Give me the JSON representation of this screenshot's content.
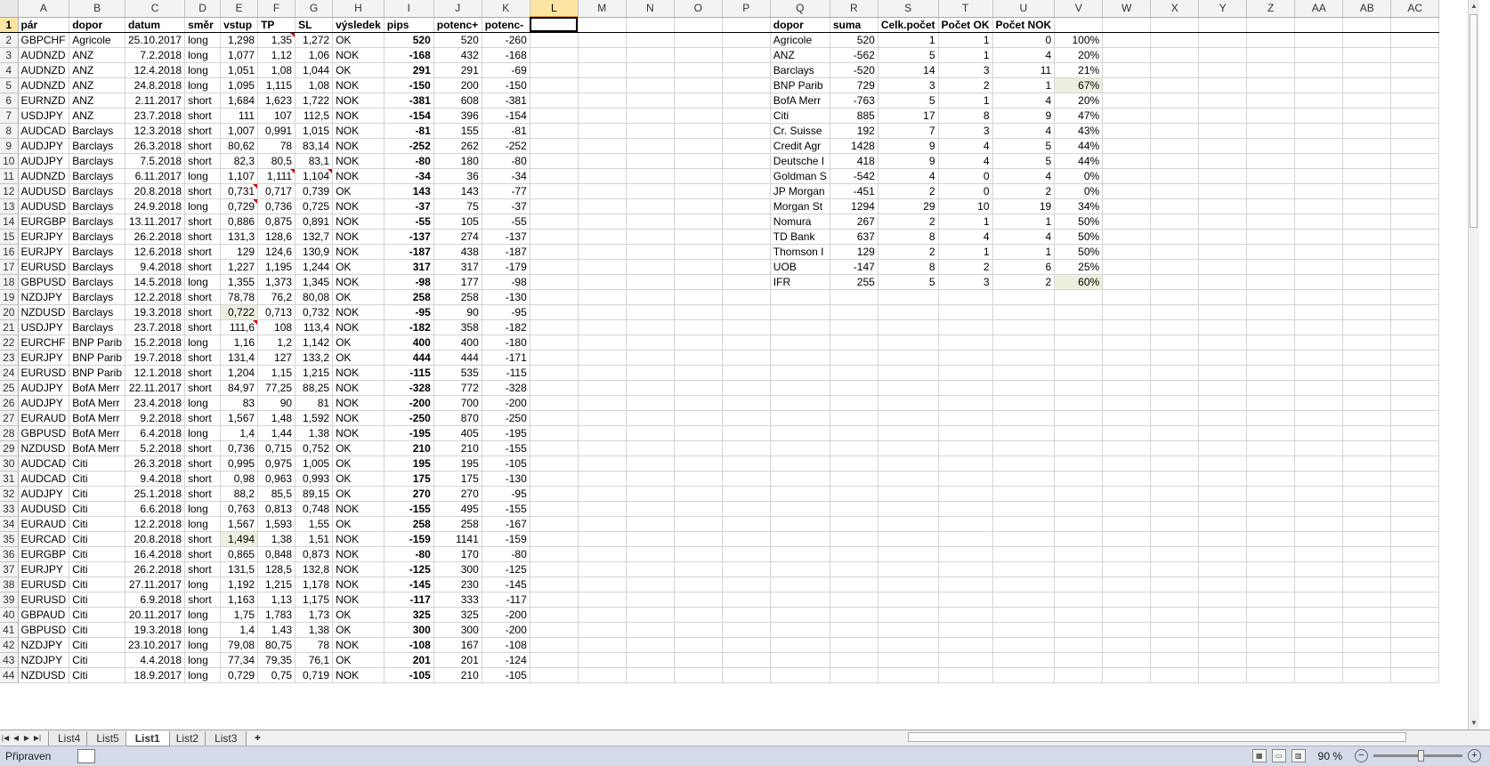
{
  "columns": [
    "A",
    "B",
    "C",
    "D",
    "E",
    "F",
    "G",
    "H",
    "I",
    "J",
    "K",
    "L",
    "M",
    "N",
    "O",
    "P",
    "Q",
    "R",
    "S",
    "T",
    "U",
    "V",
    "W",
    "X",
    "Y",
    "Z",
    "AA",
    "AB",
    "AC"
  ],
  "left_headers": [
    "pár",
    "dopor",
    "datum",
    "směr",
    "vstup",
    "TP",
    "SL",
    "výsledek",
    "pips",
    "potenc+",
    "potenc-"
  ],
  "right_headers": [
    "dopor",
    "suma",
    "Celk.počet",
    "Počet OK",
    "Počet NOK",
    ""
  ],
  "rows": [
    [
      "GBPCHF",
      "Agricole",
      "25.10.2017",
      "long",
      "1,298",
      "1,35",
      "1,272",
      "OK",
      "520",
      "520",
      "-260"
    ],
    [
      "AUDNZD",
      "ANZ",
      "7.2.2018",
      "long",
      "1,077",
      "1,12",
      "1,06",
      "NOK",
      "-168",
      "432",
      "-168"
    ],
    [
      "AUDNZD",
      "ANZ",
      "12.4.2018",
      "long",
      "1,051",
      "1,08",
      "1,044",
      "OK",
      "291",
      "291",
      "-69"
    ],
    [
      "AUDNZD",
      "ANZ",
      "24.8.2018",
      "long",
      "1,095",
      "1,115",
      "1,08",
      "NOK",
      "-150",
      "200",
      "-150"
    ],
    [
      "EURNZD",
      "ANZ",
      "2.11.2017",
      "short",
      "1,684",
      "1,623",
      "1,722",
      "NOK",
      "-381",
      "608",
      "-381"
    ],
    [
      "USDJPY",
      "ANZ",
      "23.7.2018",
      "short",
      "111",
      "107",
      "112,5",
      "NOK",
      "-154",
      "396",
      "-154"
    ],
    [
      "AUDCAD",
      "Barclays",
      "12.3.2018",
      "short",
      "1,007",
      "0,991",
      "1,015",
      "NOK",
      "-81",
      "155",
      "-81"
    ],
    [
      "AUDJPY",
      "Barclays",
      "26.3.2018",
      "short",
      "80,62",
      "78",
      "83,14",
      "NOK",
      "-252",
      "262",
      "-252"
    ],
    [
      "AUDJPY",
      "Barclays",
      "7.5.2018",
      "short",
      "82,3",
      "80,5",
      "83,1",
      "NOK",
      "-80",
      "180",
      "-80"
    ],
    [
      "AUDNZD",
      "Barclays",
      "6.11.2017",
      "long",
      "1,107",
      "1,111",
      "1,104",
      "NOK",
      "-34",
      "36",
      "-34"
    ],
    [
      "AUDUSD",
      "Barclays",
      "20.8.2018",
      "short",
      "0,731",
      "0,717",
      "0,739",
      "OK",
      "143",
      "143",
      "-77"
    ],
    [
      "AUDUSD",
      "Barclays",
      "24.9.2018",
      "long",
      "0,729",
      "0,736",
      "0,725",
      "NOK",
      "-37",
      "75",
      "-37"
    ],
    [
      "EURGBP",
      "Barclays",
      "13.11.2017",
      "short",
      "0,886",
      "0,875",
      "0,891",
      "NOK",
      "-55",
      "105",
      "-55"
    ],
    [
      "EURJPY",
      "Barclays",
      "26.2.2018",
      "short",
      "131,3",
      "128,6",
      "132,7",
      "NOK",
      "-137",
      "274",
      "-137"
    ],
    [
      "EURJPY",
      "Barclays",
      "12.6.2018",
      "short",
      "129",
      "124,6",
      "130,9",
      "NOK",
      "-187",
      "438",
      "-187"
    ],
    [
      "EURUSD",
      "Barclays",
      "9.4.2018",
      "short",
      "1,227",
      "1,195",
      "1,244",
      "OK",
      "317",
      "317",
      "-179"
    ],
    [
      "GBPUSD",
      "Barclays",
      "14.5.2018",
      "long",
      "1,355",
      "1,373",
      "1,345",
      "NOK",
      "-98",
      "177",
      "-98"
    ],
    [
      "NZDJPY",
      "Barclays",
      "12.2.2018",
      "short",
      "78,78",
      "76,2",
      "80,08",
      "OK",
      "258",
      "258",
      "-130"
    ],
    [
      "NZDUSD",
      "Barclays",
      "19.3.2018",
      "short",
      "0,722",
      "0,713",
      "0,732",
      "NOK",
      "-95",
      "90",
      "-95"
    ],
    [
      "USDJPY",
      "Barclays",
      "23.7.2018",
      "short",
      "111,6",
      "108",
      "113,4",
      "NOK",
      "-182",
      "358",
      "-182"
    ],
    [
      "EURCHF",
      "BNP Parib",
      "15.2.2018",
      "long",
      "1,16",
      "1,2",
      "1,142",
      "OK",
      "400",
      "400",
      "-180"
    ],
    [
      "EURJPY",
      "BNP Parib",
      "19.7.2018",
      "short",
      "131,4",
      "127",
      "133,2",
      "OK",
      "444",
      "444",
      "-171"
    ],
    [
      "EURUSD",
      "BNP Parib",
      "12.1.2018",
      "short",
      "1,204",
      "1,15",
      "1,215",
      "NOK",
      "-115",
      "535",
      "-115"
    ],
    [
      "AUDJPY",
      "BofA Merr",
      "22.11.2017",
      "short",
      "84,97",
      "77,25",
      "88,25",
      "NOK",
      "-328",
      "772",
      "-328"
    ],
    [
      "AUDJPY",
      "BofA Merr",
      "23.4.2018",
      "long",
      "83",
      "90",
      "81",
      "NOK",
      "-200",
      "700",
      "-200"
    ],
    [
      "EURAUD",
      "BofA Merr",
      "9.2.2018",
      "short",
      "1,567",
      "1,48",
      "1,592",
      "NOK",
      "-250",
      "870",
      "-250"
    ],
    [
      "GBPUSD",
      "BofA Merr",
      "6.4.2018",
      "long",
      "1,4",
      "1,44",
      "1,38",
      "NOK",
      "-195",
      "405",
      "-195"
    ],
    [
      "NZDUSD",
      "BofA Merr",
      "5.2.2018",
      "short",
      "0,736",
      "0,715",
      "0,752",
      "OK",
      "210",
      "210",
      "-155"
    ],
    [
      "AUDCAD",
      "Citi",
      "26.3.2018",
      "short",
      "0,995",
      "0,975",
      "1,005",
      "OK",
      "195",
      "195",
      "-105"
    ],
    [
      "AUDCAD",
      "Citi",
      "9.4.2018",
      "short",
      "0,98",
      "0,963",
      "0,993",
      "OK",
      "175",
      "175",
      "-130"
    ],
    [
      "AUDJPY",
      "Citi",
      "25.1.2018",
      "short",
      "88,2",
      "85,5",
      "89,15",
      "OK",
      "270",
      "270",
      "-95"
    ],
    [
      "AUDUSD",
      "Citi",
      "6.6.2018",
      "long",
      "0,763",
      "0,813",
      "0,748",
      "NOK",
      "-155",
      "495",
      "-155"
    ],
    [
      "EURAUD",
      "Citi",
      "12.2.2018",
      "long",
      "1,567",
      "1,593",
      "1,55",
      "OK",
      "258",
      "258",
      "-167"
    ],
    [
      "EURCAD",
      "Citi",
      "20.8.2018",
      "short",
      "1,494",
      "1,38",
      "1,51",
      "NOK",
      "-159",
      "1141",
      "-159"
    ],
    [
      "EURGBP",
      "Citi",
      "16.4.2018",
      "short",
      "0,865",
      "0,848",
      "0,873",
      "NOK",
      "-80",
      "170",
      "-80"
    ],
    [
      "EURJPY",
      "Citi",
      "26.2.2018",
      "short",
      "131,5",
      "128,5",
      "132,8",
      "NOK",
      "-125",
      "300",
      "-125"
    ],
    [
      "EURUSD",
      "Citi",
      "27.11.2017",
      "long",
      "1,192",
      "1,215",
      "1,178",
      "NOK",
      "-145",
      "230",
      "-145"
    ],
    [
      "EURUSD",
      "Citi",
      "6.9.2018",
      "short",
      "1,163",
      "1,13",
      "1,175",
      "NOK",
      "-117",
      "333",
      "-117"
    ],
    [
      "GBPAUD",
      "Citi",
      "20.11.2017",
      "long",
      "1,75",
      "1,783",
      "1,73",
      "OK",
      "325",
      "325",
      "-200"
    ],
    [
      "GBPUSD",
      "Citi",
      "19.3.2018",
      "long",
      "1,4",
      "1,43",
      "1,38",
      "OK",
      "300",
      "300",
      "-200"
    ],
    [
      "NZDJPY",
      "Citi",
      "23.10.2017",
      "long",
      "79,08",
      "80,75",
      "78",
      "NOK",
      "-108",
      "167",
      "-108"
    ],
    [
      "NZDJPY",
      "Citi",
      "4.4.2018",
      "long",
      "77,34",
      "79,35",
      "76,1",
      "OK",
      "201",
      "201",
      "-124"
    ],
    [
      "NZDUSD",
      "Citi",
      "18.9.2017",
      "long",
      "0,729",
      "0,75",
      "0,719",
      "NOK",
      "-105",
      "210",
      "-105"
    ],
    [
      "USDJPY",
      "Citi",
      "5.2.2018",
      "short",
      "109,9",
      "107,5",
      "111",
      "OK",
      "235",
      "235",
      "-115"
    ]
  ],
  "summary": [
    [
      "Agricole",
      "520",
      "1",
      "1",
      "0",
      "100%"
    ],
    [
      "ANZ",
      "-562",
      "5",
      "1",
      "4",
      "20%"
    ],
    [
      "Barclays",
      "-520",
      "14",
      "3",
      "11",
      "21%"
    ],
    [
      "BNP Parib",
      "729",
      "3",
      "2",
      "1",
      "67%"
    ],
    [
      "BofA Merr",
      "-763",
      "5",
      "1",
      "4",
      "20%"
    ],
    [
      "Citi",
      "885",
      "17",
      "8",
      "9",
      "47%"
    ],
    [
      "Cr. Suisse",
      "192",
      "7",
      "3",
      "4",
      "43%"
    ],
    [
      "Credit Agr",
      "1428",
      "9",
      "4",
      "5",
      "44%"
    ],
    [
      "Deutsche I",
      "418",
      "9",
      "4",
      "5",
      "44%"
    ],
    [
      "Goldman S",
      "-542",
      "4",
      "0",
      "4",
      "0%"
    ],
    [
      "JP Morgan",
      "-451",
      "2",
      "0",
      "2",
      "0%"
    ],
    [
      "Morgan St",
      "1294",
      "29",
      "10",
      "19",
      "34%"
    ],
    [
      "Nomura",
      "267",
      "2",
      "1",
      "1",
      "50%"
    ],
    [
      "TD Bank",
      "637",
      "8",
      "4",
      "4",
      "50%"
    ],
    [
      "Thomson I",
      "129",
      "2",
      "1",
      "1",
      "50%"
    ],
    [
      "UOB",
      "-147",
      "8",
      "2",
      "6",
      "25%"
    ],
    [
      "IFR",
      "255",
      "5",
      "3",
      "2",
      "60%"
    ]
  ],
  "sheet_tabs": [
    "List4",
    "List5",
    "List1",
    "List2",
    "List3"
  ],
  "active_tab": "List1",
  "status": {
    "ready": "Připraven",
    "zoom": "90 %"
  },
  "colors": {
    "highlight": "#ebf1de",
    "selection": "#fce4a2",
    "status_bar": "#d6dbe9"
  }
}
